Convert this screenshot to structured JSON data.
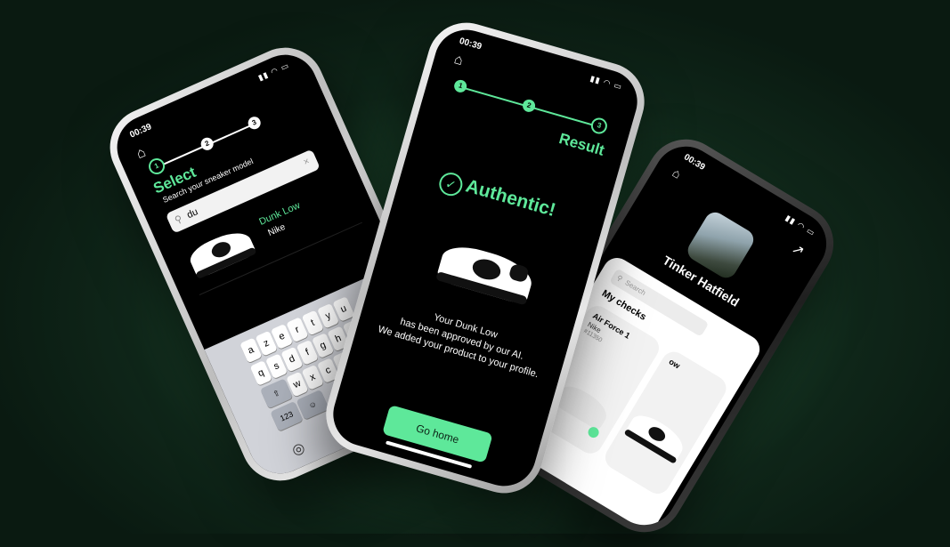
{
  "phone_select": {
    "time": "00:39",
    "steps": [
      "1",
      "2",
      "3"
    ],
    "title": "Select",
    "subtitle": "Search your sneaker model",
    "search_value": "du",
    "result": {
      "model": "Dunk Low",
      "brand": "Nike"
    },
    "keyboard": {
      "row1": [
        "a",
        "z",
        "e",
        "r",
        "t",
        "y",
        "u"
      ],
      "row2": [
        "q",
        "s",
        "d",
        "f",
        "g",
        "h",
        "j"
      ],
      "row3": [
        "w",
        "x",
        "c",
        "v"
      ],
      "numbers_key": "123"
    }
  },
  "phone_result": {
    "time": "00:39",
    "steps": [
      "1",
      "2",
      "3"
    ],
    "step_label": "Result",
    "status": "Authentic!",
    "message_line1": "Your Dunk Low",
    "message_line2": "has been approved by our AI.",
    "message_line3": "We added your product to your profile.",
    "button": "Go home"
  },
  "phone_profile": {
    "time": "00:39",
    "name": "Tinker Hatfield",
    "section": "My checks",
    "search_placeholder": "Search",
    "check": {
      "model": "Air Force 1",
      "brand": "Nike",
      "ref": "#11350"
    },
    "partial_label": "ow"
  },
  "colors": {
    "accent": "#5ee89a",
    "background": "#143822"
  }
}
